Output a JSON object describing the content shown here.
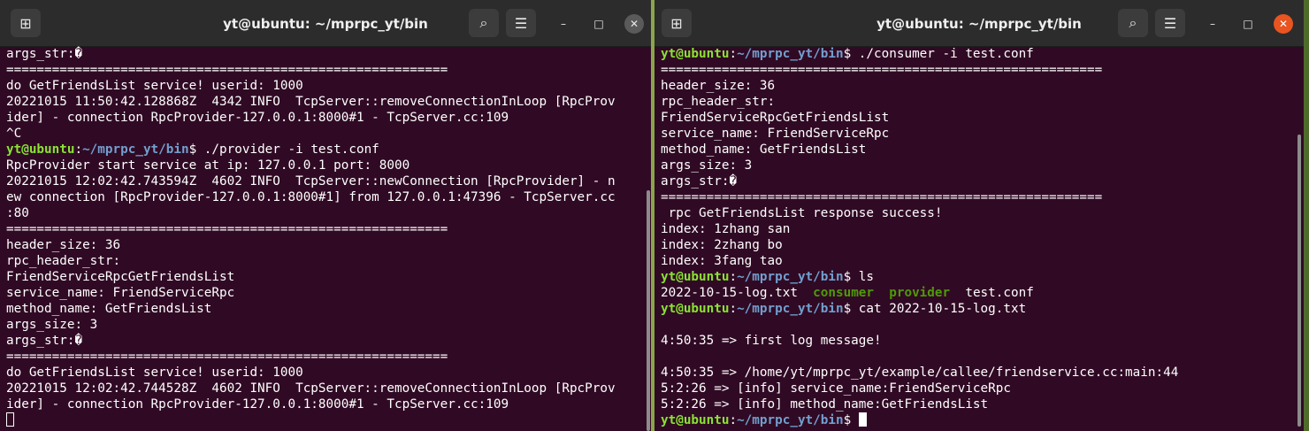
{
  "left": {
    "title": "yt@ubuntu: ~/mprpc_yt/bin",
    "lines": [
      {
        "t": "args_str:�"
      },
      {
        "t": "=========================================================="
      },
      {
        "t": "do GetFriendsList service! userid: 1000"
      },
      {
        "t": "20221015 11:50:42.128868Z  4342 INFO  TcpServer::removeConnectionInLoop [RpcProv"
      },
      {
        "t": "ider] - connection RpcProvider-127.0.0.1:8000#1 - TcpServer.cc:109"
      },
      {
        "t": "^C"
      },
      {
        "prompt": true,
        "user": "yt@ubuntu",
        "path": "~/mprpc_yt/bin",
        "cmd": " ./provider -i test.conf"
      },
      {
        "t": "RpcProvider start service at ip: 127.0.0.1 port: 8000"
      },
      {
        "t": "20221015 12:02:42.743594Z  4602 INFO  TcpServer::newConnection [RpcProvider] - n"
      },
      {
        "t": "ew connection [RpcProvider-127.0.0.1:8000#1] from 127.0.0.1:47396 - TcpServer.cc"
      },
      {
        "t": ":80"
      },
      {
        "t": "=========================================================="
      },
      {
        "t": "header_size: 36"
      },
      {
        "t": "rpc_header_str:"
      },
      {
        "t": "FriendServiceRpcGetFriendsList"
      },
      {
        "t": "service_name: FriendServiceRpc"
      },
      {
        "t": "method_name: GetFriendsList"
      },
      {
        "t": "args_size: 3"
      },
      {
        "t": "args_str:�"
      },
      {
        "t": "=========================================================="
      },
      {
        "t": "do GetFriendsList service! userid: 1000"
      },
      {
        "t": "20221015 12:02:42.744528Z  4602 INFO  TcpServer::removeConnectionInLoop [RpcProv"
      },
      {
        "t": "ider] - connection RpcProvider-127.0.0.1:8000#1 - TcpServer.cc:109"
      },
      {
        "cursor": "hollow"
      }
    ]
  },
  "right": {
    "title": "yt@ubuntu: ~/mprpc_yt/bin",
    "lines": [
      {
        "prompt": true,
        "user": "yt@ubuntu",
        "path": "~/mprpc_yt/bin",
        "cmd": " ./consumer -i test.conf"
      },
      {
        "t": "=========================================================="
      },
      {
        "t": "header_size: 36"
      },
      {
        "t": "rpc_header_str:"
      },
      {
        "t": "FriendServiceRpcGetFriendsList"
      },
      {
        "t": "service_name: FriendServiceRpc"
      },
      {
        "t": "method_name: GetFriendsList"
      },
      {
        "t": "args_size: 3"
      },
      {
        "t": "args_str:�"
      },
      {
        "t": "=========================================================="
      },
      {
        "t": " rpc GetFriendsList response success!"
      },
      {
        "t": "index: 1zhang san"
      },
      {
        "t": "index: 2zhang bo"
      },
      {
        "t": "index: 3fang tao"
      },
      {
        "prompt": true,
        "user": "yt@ubuntu",
        "path": "~/mprpc_yt/bin",
        "cmd": " ls"
      },
      {
        "ls": [
          {
            "t": "2022-10-15-log.txt",
            "c": "plain"
          },
          {
            "t": "  "
          },
          {
            "t": "consumer",
            "c": "exec"
          },
          {
            "t": "  "
          },
          {
            "t": "provider",
            "c": "exec"
          },
          {
            "t": "  "
          },
          {
            "t": "test.conf",
            "c": "plain"
          }
        ]
      },
      {
        "prompt": true,
        "user": "yt@ubuntu",
        "path": "~/mprpc_yt/bin",
        "cmd": " cat 2022-10-15-log.txt"
      },
      {
        "t": ""
      },
      {
        "t": "4:50:35 => first log message!"
      },
      {
        "t": ""
      },
      {
        "t": "4:50:35 => /home/yt/mprpc_yt/example/callee/friendservice.cc:main:44"
      },
      {
        "t": "5:2:26 => [info] service_name:FriendServiceRpc"
      },
      {
        "t": "5:2:26 => [info] method_name:GetFriendsList"
      },
      {
        "prompt": true,
        "user": "yt@ubuntu",
        "path": "~/mprpc_yt/bin",
        "cmd": " ",
        "cursor": "solid"
      }
    ]
  },
  "icons": {
    "new_tab": "new-tab-icon",
    "search": "search-icon",
    "menu": "hamburger-menu-icon",
    "minimize": "minimize-icon",
    "maximize": "maximize-icon",
    "close": "close-icon"
  },
  "colors": {
    "terminal_bg": "#300a24",
    "user_green": "#8ae234",
    "path_blue": "#729fcf",
    "exec_green": "#4e9a06",
    "close_orange": "#e95420"
  }
}
